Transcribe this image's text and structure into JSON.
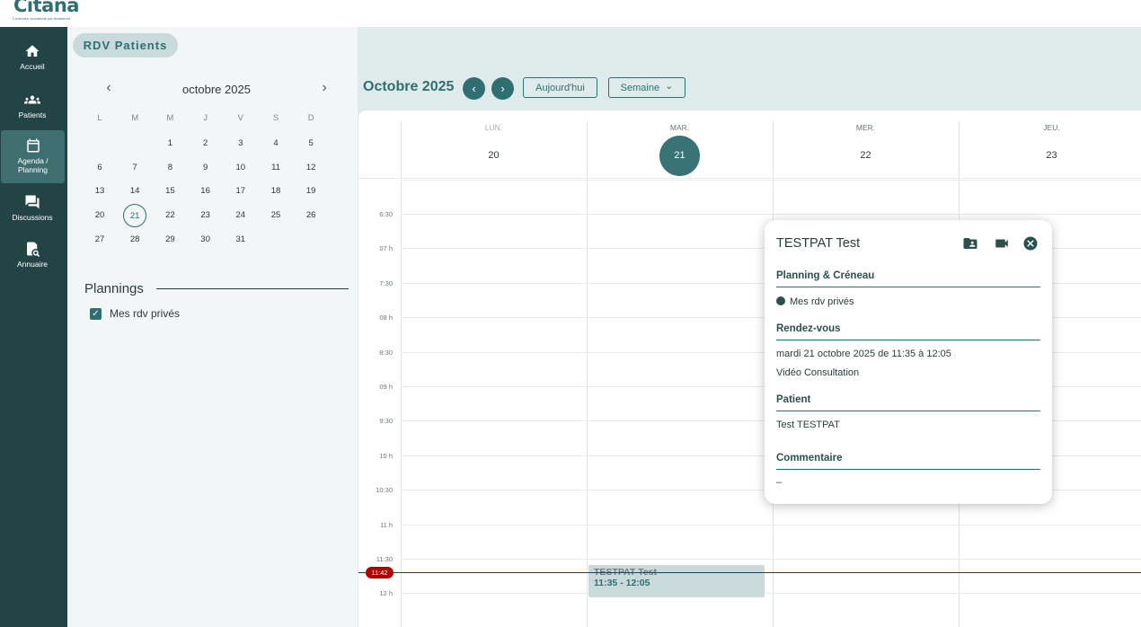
{
  "app": {
    "logo": "Citana",
    "tagline": "L'exercice coordonné par Amaneuro"
  },
  "nav": [
    {
      "label": "Accueil",
      "icon": "home-icon"
    },
    {
      "label": "Patients",
      "icon": "people-icon"
    },
    {
      "label": "Agenda / Planning",
      "icon": "calendar-icon",
      "active": true
    },
    {
      "label": "Discussions",
      "icon": "chat-icon"
    },
    {
      "label": "Annuaire",
      "icon": "directory-search-icon"
    }
  ],
  "page": {
    "chip": "RDV Patients"
  },
  "mini_calendar": {
    "title": "octobre 2025",
    "prev": "‹",
    "next": "›",
    "weekdays": [
      "L",
      "M",
      "M",
      "J",
      "V",
      "S",
      "D"
    ],
    "weeks": [
      [
        "",
        "",
        "1",
        "2",
        "3",
        "4",
        "5"
      ],
      [
        "6",
        "7",
        "8",
        "9",
        "10",
        "11",
        "12"
      ],
      [
        "13",
        "14",
        "15",
        "16",
        "17",
        "18",
        "19"
      ],
      [
        "20",
        "21",
        "22",
        "23",
        "24",
        "25",
        "26"
      ],
      [
        "27",
        "28",
        "29",
        "30",
        "31",
        "",
        ""
      ]
    ],
    "today": "21"
  },
  "plannings": {
    "title": "Plannings",
    "items": [
      {
        "label": "Mes rdv privés",
        "checked": true
      }
    ]
  },
  "calendar": {
    "title": "Octobre 2025",
    "prev": "‹",
    "next": "›",
    "today_button": "Aujourd'hui",
    "view_button": "Semaine",
    "view_caret": "⌄",
    "days": [
      {
        "name": "LUN.",
        "num": "20",
        "past": true
      },
      {
        "name": "MAR.",
        "num": "21",
        "today": true
      },
      {
        "name": "MER.",
        "num": "22"
      },
      {
        "name": "JEU.",
        "num": "23"
      }
    ],
    "times": [
      "6:30",
      "07 h",
      "7:30",
      "08 h",
      "8:30",
      "09 h",
      "9:30",
      "10 h",
      "10:30",
      "11 h",
      "11:30",
      "12 h"
    ],
    "now_label": "11:42",
    "event": {
      "title": "TESTPAT Test",
      "time": "11:35 - 12:05"
    }
  },
  "popup": {
    "title": "TESTPAT Test",
    "sections": {
      "planning_title": "Planning & Créneau",
      "planning_value": "Mes rdv privés",
      "rdv_title": "Rendez-vous",
      "rdv_date": "mardi 21 octobre 2025 de 11:35 à 12:05",
      "rdv_type": "Vidéo Consultation",
      "patient_title": "Patient",
      "patient_value": "Test TESTPAT",
      "comment_title": "Commentaire",
      "comment_value": "–"
    }
  },
  "colors": {
    "primary": "#2f6f72",
    "sidebar": "#224445",
    "now": "#b00000"
  }
}
